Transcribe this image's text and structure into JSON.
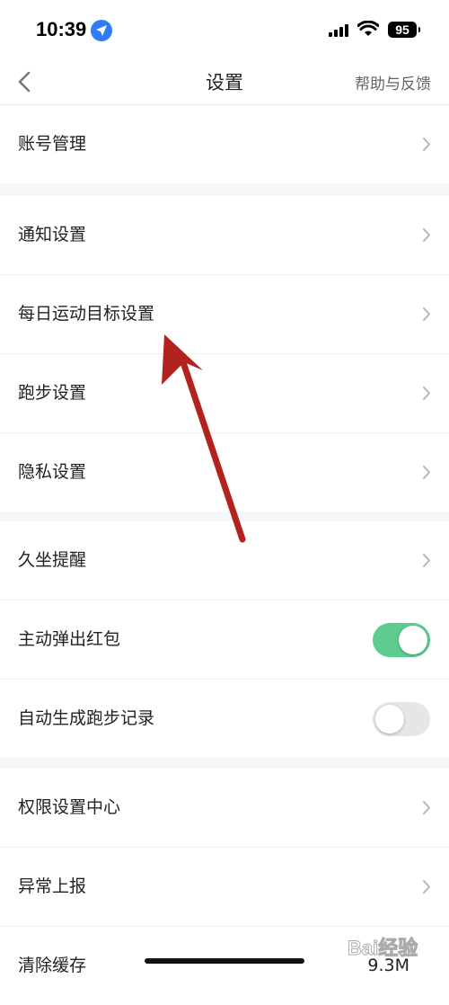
{
  "status_bar": {
    "time": "10:39",
    "battery": "95",
    "icons": [
      "location-arrow-icon",
      "signal-bars-icon",
      "wifi-icon",
      "battery-icon"
    ]
  },
  "nav": {
    "title": "设置",
    "help": "帮助与反馈",
    "back_icon": "chevron-left-icon"
  },
  "groups": [
    {
      "items": [
        {
          "label": "账号管理",
          "type": "chevron"
        }
      ]
    },
    {
      "items": [
        {
          "label": "通知设置",
          "type": "chevron"
        },
        {
          "label": "每日运动目标设置",
          "type": "chevron"
        },
        {
          "label": "跑步设置",
          "type": "chevron"
        },
        {
          "label": "隐私设置",
          "type": "chevron"
        }
      ]
    },
    {
      "items": [
        {
          "label": "久坐提醒",
          "type": "chevron"
        },
        {
          "label": "主动弹出红包",
          "type": "toggle",
          "on": true
        },
        {
          "label": "自动生成跑步记录",
          "type": "toggle",
          "on": false
        }
      ]
    },
    {
      "items": [
        {
          "label": "权限设置中心",
          "type": "chevron"
        },
        {
          "label": "异常上报",
          "type": "chevron"
        },
        {
          "label": "清除缓存",
          "type": "value",
          "value": "9.3M"
        }
      ]
    }
  ],
  "watermark": "Bai经验",
  "colors": {
    "toggle_on": "#5ccc8f",
    "toggle_off": "#e6e6e8",
    "annotation_arrow": "#b3231d",
    "location_icon": "#2f7cf6"
  }
}
